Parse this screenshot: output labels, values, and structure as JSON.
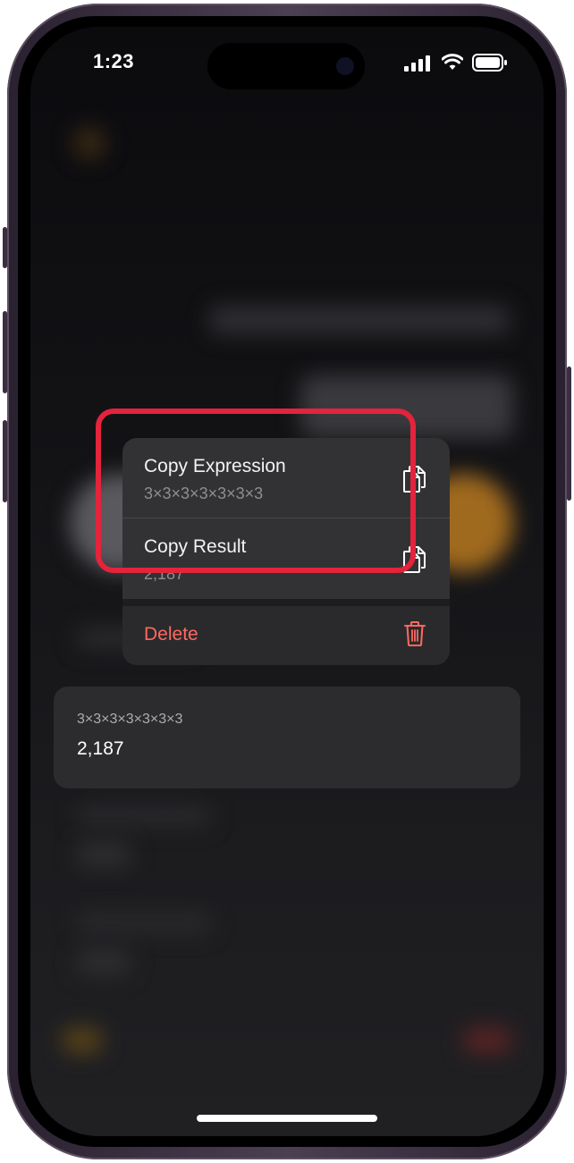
{
  "status_bar": {
    "time": "1:23"
  },
  "context_menu": {
    "items": [
      {
        "title": "Copy Expression",
        "subtitle": "3×3×3×3×3×3×3",
        "icon": "copy-icon"
      },
      {
        "title": "Copy Result",
        "subtitle": "2,187",
        "icon": "copy-icon"
      }
    ],
    "delete": {
      "title": "Delete",
      "icon": "trash-icon",
      "color": "#ff6961"
    }
  },
  "history_card": {
    "expression": "3×3×3×3×3×3×3",
    "result": "2,187"
  },
  "colors": {
    "highlight": "#e4233c",
    "menu_bg": "#323234",
    "card_bg": "#2c2c2e"
  }
}
